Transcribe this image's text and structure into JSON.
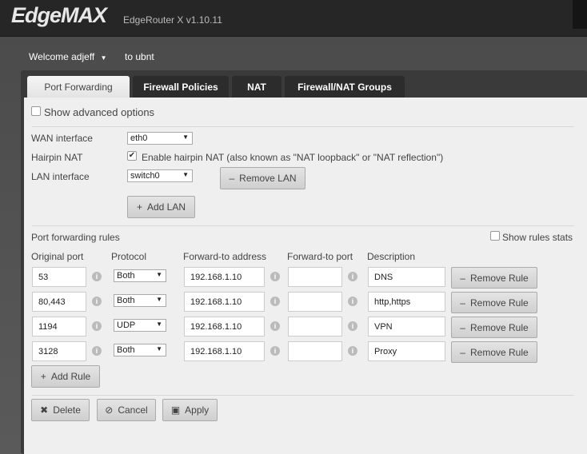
{
  "header": {
    "logo": "EdgeMAX",
    "version": "EdgeRouter X v1.10.11"
  },
  "user": {
    "welcome": "Welcome adjeff",
    "to": "to ubnt"
  },
  "tabs": [
    "Port Forwarding",
    "Firewall Policies",
    "NAT",
    "Firewall/NAT Groups"
  ],
  "form": {
    "show_advanced": "Show advanced options",
    "wan_label": "WAN interface",
    "wan_value": "eth0",
    "hairpin_label": "Hairpin NAT",
    "hairpin_text": "Enable hairpin NAT (also known as \"NAT loopback\" or \"NAT reflection\")",
    "hairpin_checked": true,
    "lan_label": "LAN interface",
    "lan_value": "switch0",
    "remove_lan": "Remove LAN",
    "add_lan": "Add LAN"
  },
  "rules": {
    "title": "Port forwarding rules",
    "show_stats": "Show rules stats",
    "headers": [
      "Original port",
      "Protocol",
      "Forward-to address",
      "Forward-to port",
      "Description"
    ],
    "rows": [
      {
        "port": "53",
        "protocol": "Both",
        "address": "192.168.1.10",
        "fport": "",
        "desc": "DNS"
      },
      {
        "port": "80,443",
        "protocol": "Both",
        "address": "192.168.1.10",
        "fport": "",
        "desc": "http,https"
      },
      {
        "port": "1194",
        "protocol": "UDP",
        "address": "192.168.1.10",
        "fport": "",
        "desc": "VPN"
      },
      {
        "port": "3128",
        "protocol": "Both",
        "address": "192.168.1.10",
        "fport": "",
        "desc": "Proxy"
      }
    ],
    "remove_rule": "Remove Rule",
    "add_rule": "Add Rule"
  },
  "actions": {
    "delete": "Delete",
    "cancel": "Cancel",
    "apply": "Apply"
  }
}
